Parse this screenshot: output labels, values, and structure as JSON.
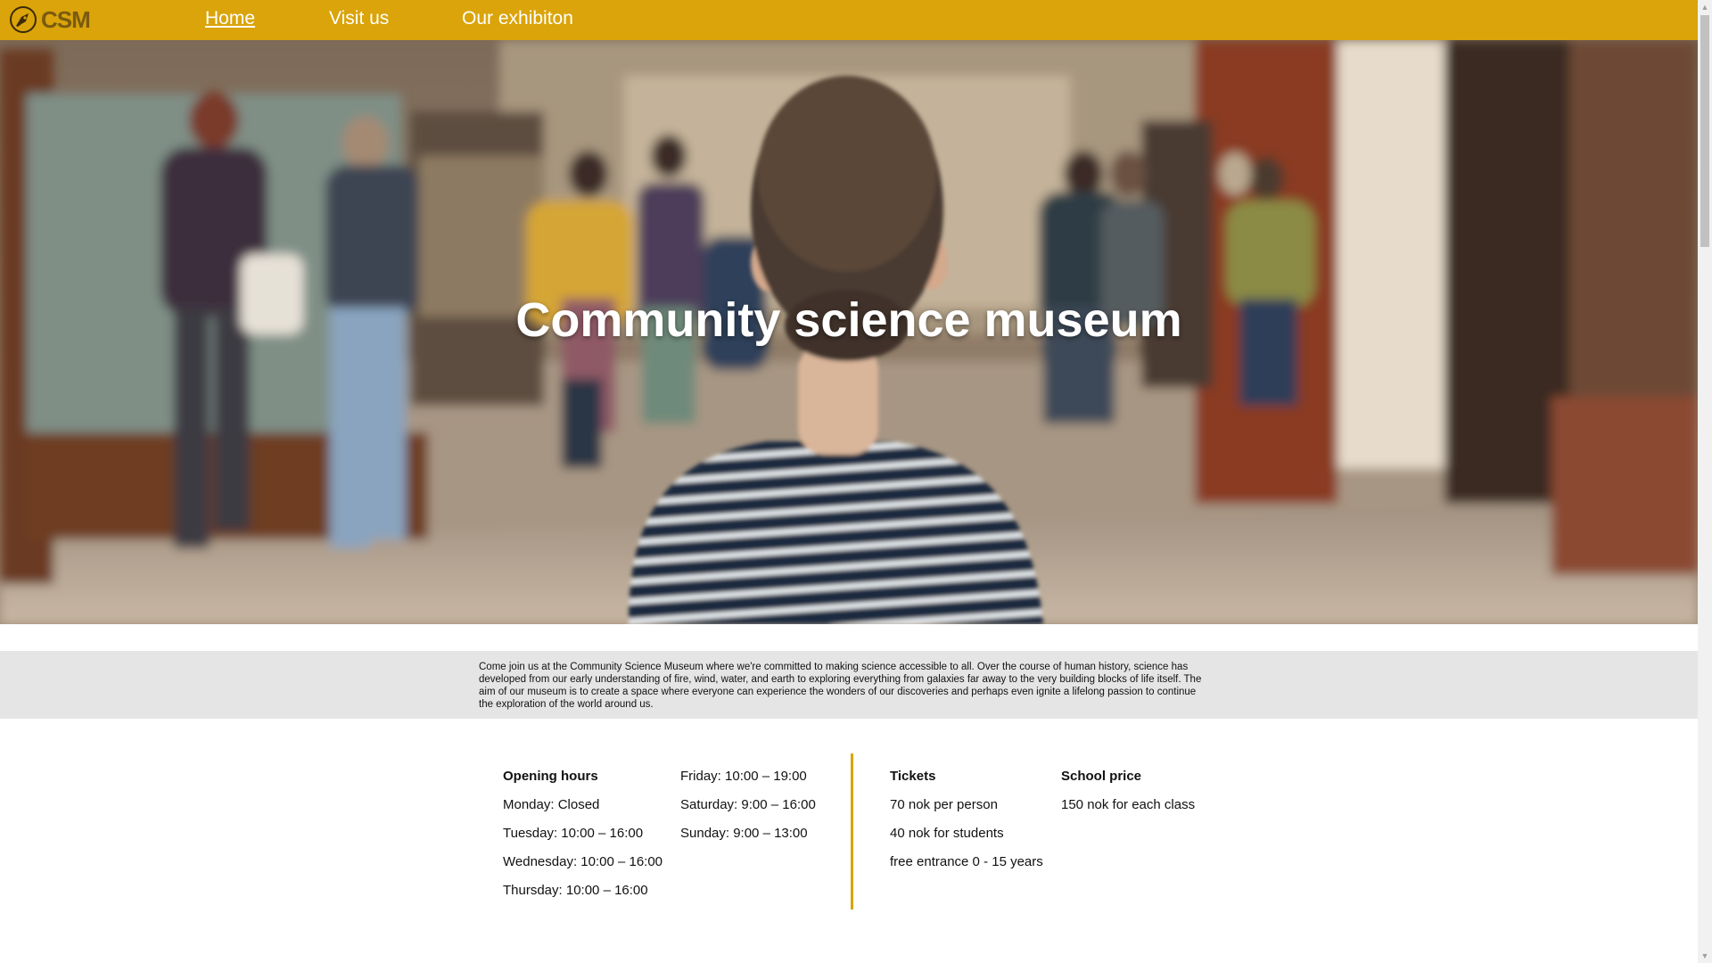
{
  "nav": {
    "logo_text": "CSM",
    "links": [
      "Home",
      "Visit us",
      "Our exhibiton"
    ],
    "active_index": 0
  },
  "hero": {
    "title": "Community science museum"
  },
  "intro": {
    "text": "Come join us at the Community Science Museum where we're committed to making science accessible to all. Over the course of human history, science has developed from our early understanding of fire, wind, water, and earth to exploring everything from galaxies far away to the very building blocks of life itself. The aim of our museum is to create a space where everyone can experience the wonders of our discoveries and perhaps even ignite a lifelong passion to continue the exploration of the world around us."
  },
  "opening_hours": {
    "heading": "Opening hours",
    "col1": [
      "Monday: Closed",
      "Tuesday: 10:00 – 16:00",
      "Wednesday: 10:00 – 16:00",
      "Thursday: 10:00 – 16:00"
    ],
    "col2": [
      "Friday: 10:00 – 19:00",
      "Saturday: 9:00 – 16:00",
      "Sunday: 9:00 – 13:00"
    ]
  },
  "tickets": {
    "heading": "Tickets",
    "items": [
      "70 nok per person",
      "40 nok for students",
      "free entrance 0 - 15 years"
    ]
  },
  "school": {
    "heading": "School price",
    "items": [
      "150 nok for each class"
    ]
  },
  "colors": {
    "nav_bg": "#daa40a",
    "accent": "#daa40a",
    "intro_bg": "#e5e5e5"
  }
}
